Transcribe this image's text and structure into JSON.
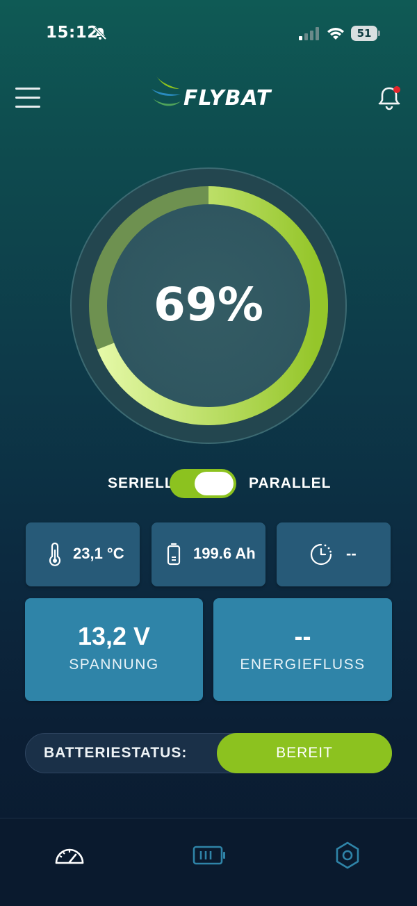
{
  "status_bar": {
    "time": "15:12",
    "battery_level": "51",
    "icons": [
      "bell-muted-icon",
      "signal-icon",
      "wifi-icon",
      "battery-icon"
    ]
  },
  "header": {
    "logo_text": "FLYBAT",
    "menu_icon": "hamburger-menu-icon",
    "notification_icon": "bell-icon",
    "notification_dot_color": "#e3262c"
  },
  "gauge": {
    "percent_value": 69,
    "percent_label": "69%",
    "fill_color": "#a8d83a",
    "track_color": "#6e9150"
  },
  "mode": {
    "left_label": "SERIELL",
    "right_label": "PARALLEL",
    "selected": "PARALLEL"
  },
  "stats": {
    "temperature": "23,1 °C",
    "capacity": "199.6 Ah",
    "time_remaining": "--"
  },
  "cards": {
    "voltage_value": "13,2 V",
    "voltage_label": "SPANNUNG",
    "energy_value": "--",
    "energy_label": "ENERGIEFLUSS"
  },
  "battery_status": {
    "label": "BATTERIESTATUS:",
    "value": "BEREIT"
  },
  "tabbar": {
    "tabs": [
      {
        "icon": "speedometer-icon",
        "active": true
      },
      {
        "icon": "battery-icon",
        "active": false
      },
      {
        "icon": "hexagon-nut-icon",
        "active": false
      }
    ]
  },
  "colors": {
    "accent_green": "#8cc21f",
    "card_small": "#275a78",
    "card_big": "#2f84a8",
    "inactive_icon": "#2f84a8"
  }
}
